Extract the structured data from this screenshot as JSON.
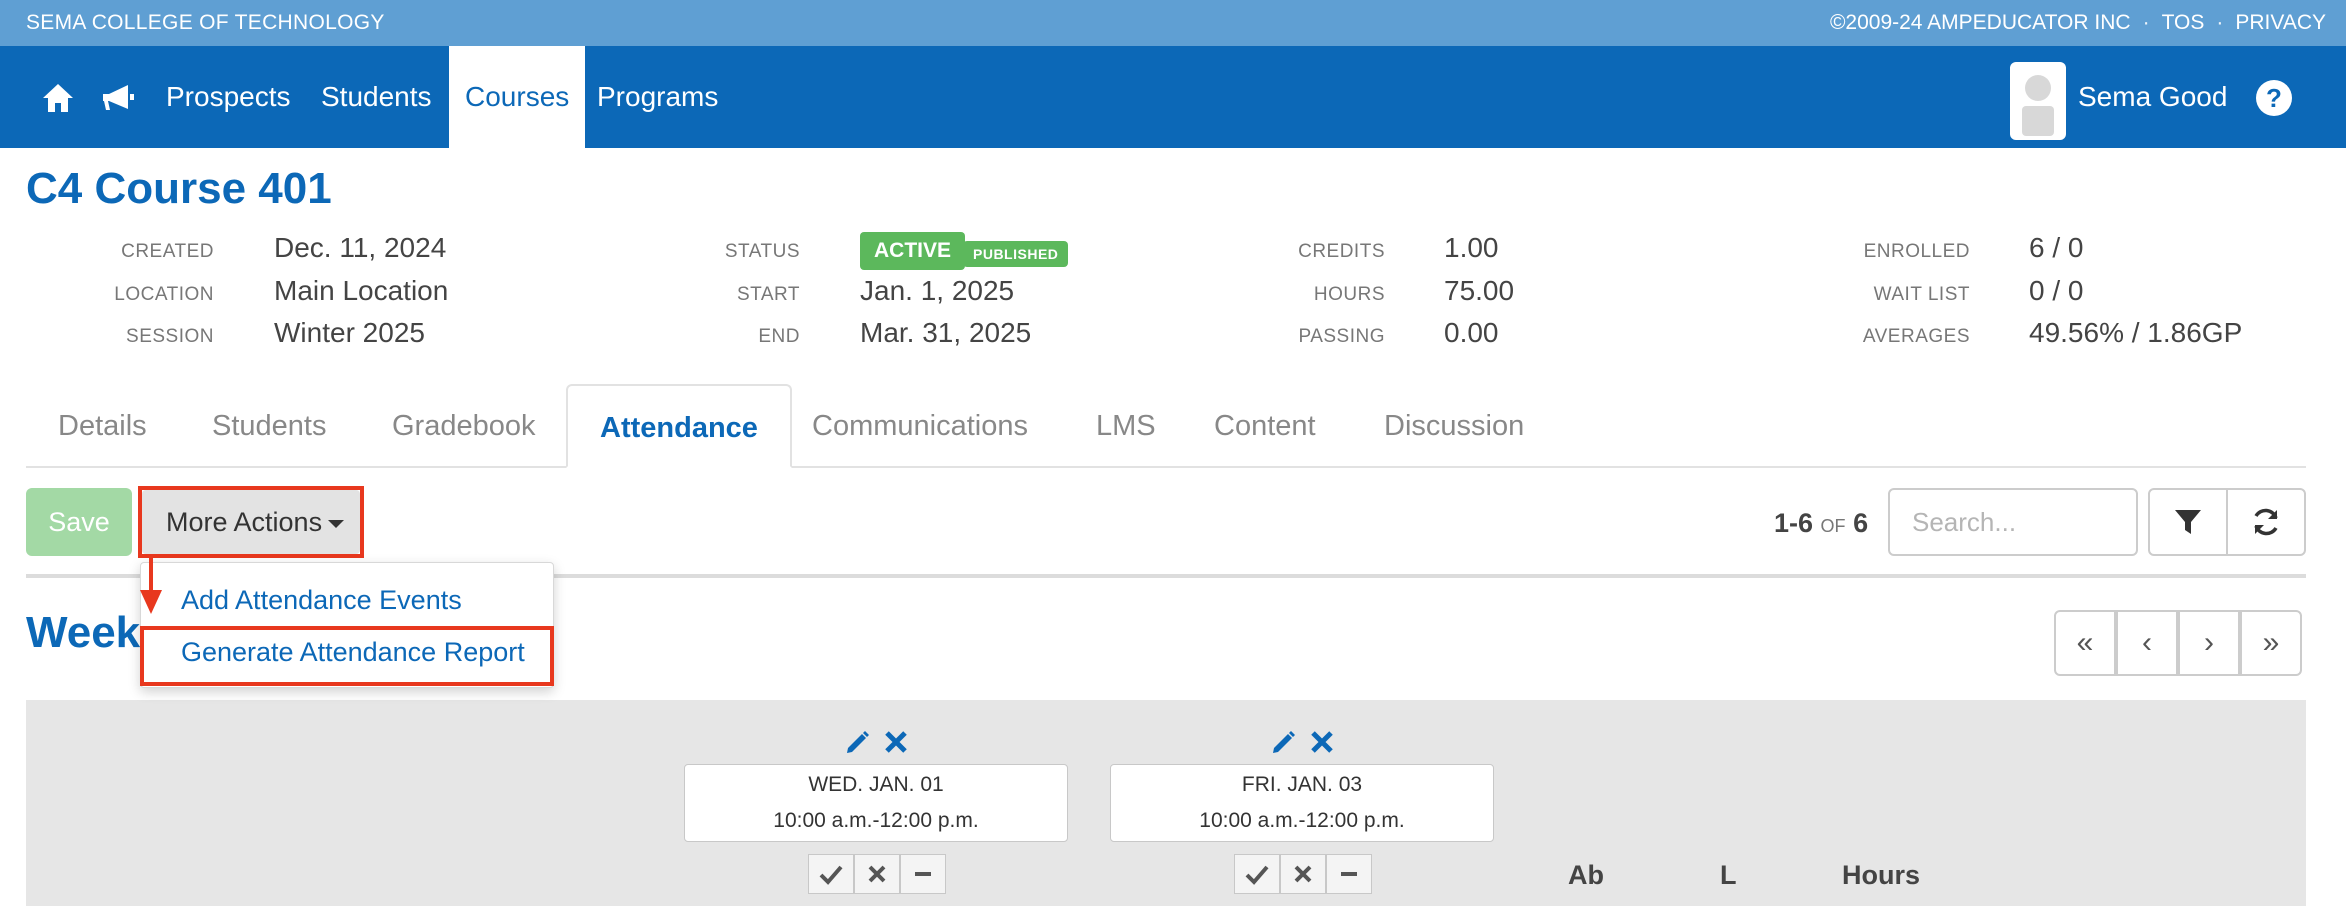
{
  "topbar": {
    "school": "SEMA COLLEGE OF TECHNOLOGY",
    "copyright": "©2009-24 AMPEDUCATOR INC",
    "sep": "·",
    "tos": "TOS",
    "privacy": "PRIVACY"
  },
  "nav": {
    "items": [
      "Prospects",
      "Students",
      "Courses",
      "Programs"
    ],
    "active": "Courses",
    "user_name": "Sema Good",
    "help": "?"
  },
  "course": {
    "title": "C4 Course 401",
    "fields": {
      "created_label": "CREATED",
      "created": "Dec. 11, 2024",
      "location_label": "LOCATION",
      "location": "Main Location",
      "session_label": "SESSION",
      "session": "Winter 2025",
      "status_label": "STATUS",
      "status": "ACTIVE",
      "published": "PUBLISHED",
      "start_label": "START",
      "start": "Jan. 1, 2025",
      "end_label": "END",
      "end": "Mar. 31, 2025",
      "credits_label": "CREDITS",
      "credits": "1.00",
      "hours_label": "HOURS",
      "hours": "75.00",
      "passing_label": "PASSING",
      "passing": "0.00",
      "enrolled_label": "ENROLLED",
      "enrolled": "6 / 0",
      "waitlist_label": "WAIT LIST",
      "waitlist": "0 / 0",
      "averages_label": "AVERAGES",
      "averages": "49.56% / 1.86GP"
    }
  },
  "tabs": [
    "Details",
    "Students",
    "Gradebook",
    "Attendance",
    "Communications",
    "LMS",
    "Content",
    "Discussion"
  ],
  "active_tab": "Attendance",
  "toolbar": {
    "save": "Save",
    "more_actions": "More Actions",
    "range": "1-6",
    "of": "OF",
    "total": "6",
    "search_placeholder": "Search..."
  },
  "dropdown": {
    "items": [
      "Add Attendance Events",
      "Generate Attendance Report"
    ]
  },
  "week": {
    "title": "Week",
    "pager": [
      "«",
      "‹",
      "›",
      "»"
    ]
  },
  "events": [
    {
      "date": "WED. JAN. 01",
      "time": "10:00 a.m.-12:00 p.m."
    },
    {
      "date": "FRI. JAN. 03",
      "time": "10:00 a.m.-12:00 p.m."
    }
  ],
  "columns": [
    "Ab",
    "L",
    "Hours"
  ],
  "colors": {
    "topbar": "#5f9fd3",
    "navbar": "#0c68b7",
    "accent": "#0c68b7",
    "success": "#5cb85c",
    "highlight": "#e8381e"
  },
  "icons": [
    "home-icon",
    "megaphone-icon",
    "help-icon",
    "filter-icon",
    "refresh-icon",
    "pencil-icon",
    "x-icon",
    "check-icon",
    "minus-icon"
  ]
}
